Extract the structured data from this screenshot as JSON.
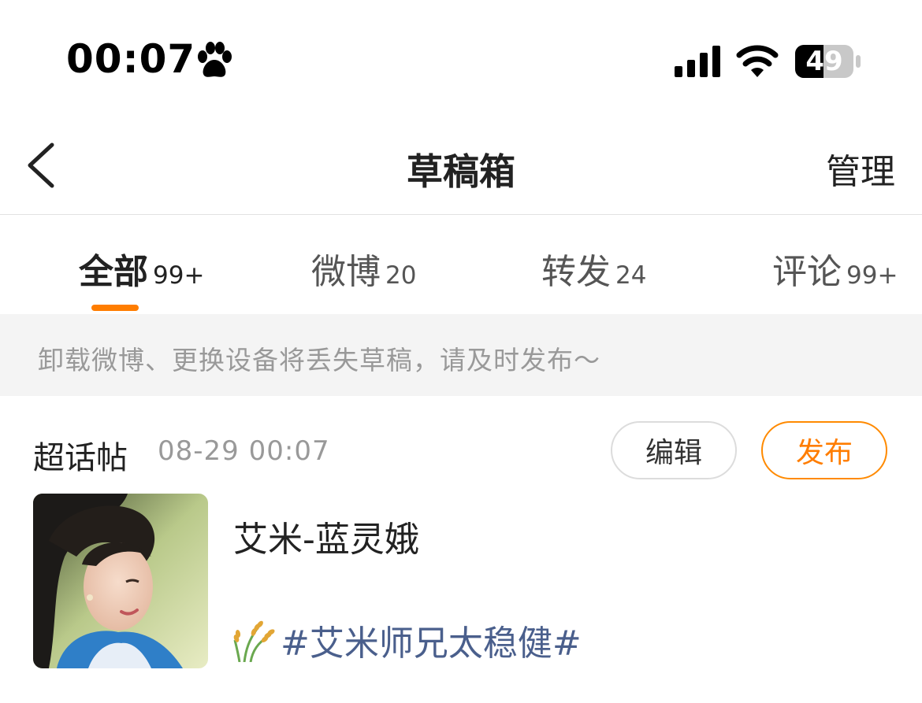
{
  "status_bar": {
    "time": "00:07",
    "battery_level": "49",
    "icons": [
      "paw-icon",
      "cellular-signal-icon",
      "wifi-icon",
      "battery-icon"
    ]
  },
  "nav": {
    "title": "草稿箱",
    "manage_label": "管理",
    "back_icon": "chevron-left-icon"
  },
  "tabs": [
    {
      "label": "全部",
      "count": "99+",
      "active": true
    },
    {
      "label": "微博",
      "count": "20",
      "active": false
    },
    {
      "label": "转发",
      "count": "24",
      "active": false
    },
    {
      "label": "评论",
      "count": "99+",
      "active": false
    }
  ],
  "notice": "卸载微博、更换设备将丢失草稿，请及时发布～",
  "draft": {
    "type": "超话帖",
    "time": "08-29 00:07",
    "edit_label": "编辑",
    "publish_label": "发布",
    "title": "艾米-蓝灵娥",
    "topic": "#艾米师兄太稳健#",
    "topic_icon": "rice-icon"
  },
  "colors": {
    "accent": "#ff7d00",
    "topic_link": "#4a5f8c",
    "muted_text": "#999999",
    "notice_bg": "#f4f4f4"
  }
}
